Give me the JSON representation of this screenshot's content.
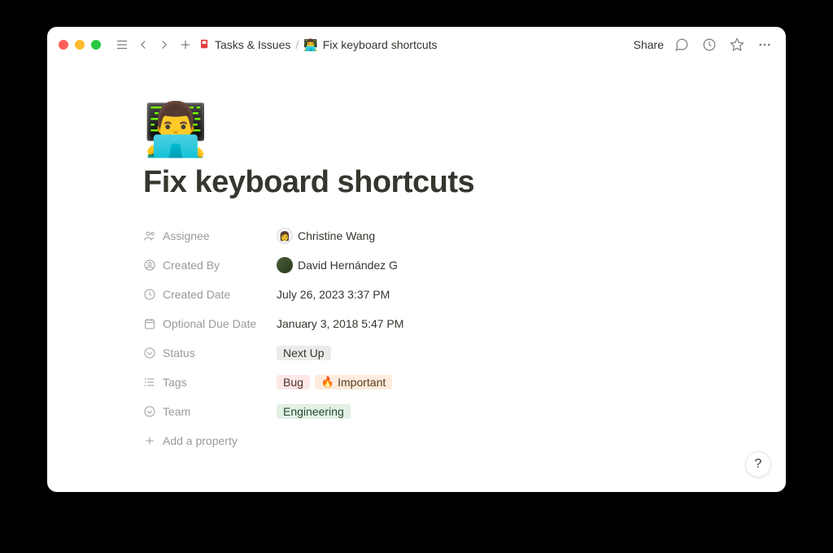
{
  "breadcrumb": {
    "parent_icon": "🔖",
    "parent_label": "Tasks & Issues",
    "separator": "/",
    "page_icon": "👨‍💻",
    "page_label": "Fix keyboard shortcuts"
  },
  "topbar": {
    "share_label": "Share"
  },
  "page": {
    "icon": "👨‍💻",
    "title": "Fix keyboard shortcuts"
  },
  "properties": {
    "assignee": {
      "label": "Assignee",
      "value": "Christine Wang"
    },
    "created_by": {
      "label": "Created By",
      "value": "David Hernández G"
    },
    "created_date": {
      "label": "Created Date",
      "value": "July 26, 2023 3:37 PM"
    },
    "due_date": {
      "label": "Optional Due Date",
      "value": "January 3, 2018 5:47 PM"
    },
    "status": {
      "label": "Status",
      "value": "Next Up"
    },
    "tags": {
      "label": "Tags",
      "items": [
        {
          "emoji": "",
          "text": "Bug",
          "color": "red"
        },
        {
          "emoji": "🔥",
          "text": "Important",
          "color": "orange"
        }
      ]
    },
    "team": {
      "label": "Team",
      "value": "Engineering"
    }
  },
  "add_property_label": "Add a property",
  "help_label": "?"
}
